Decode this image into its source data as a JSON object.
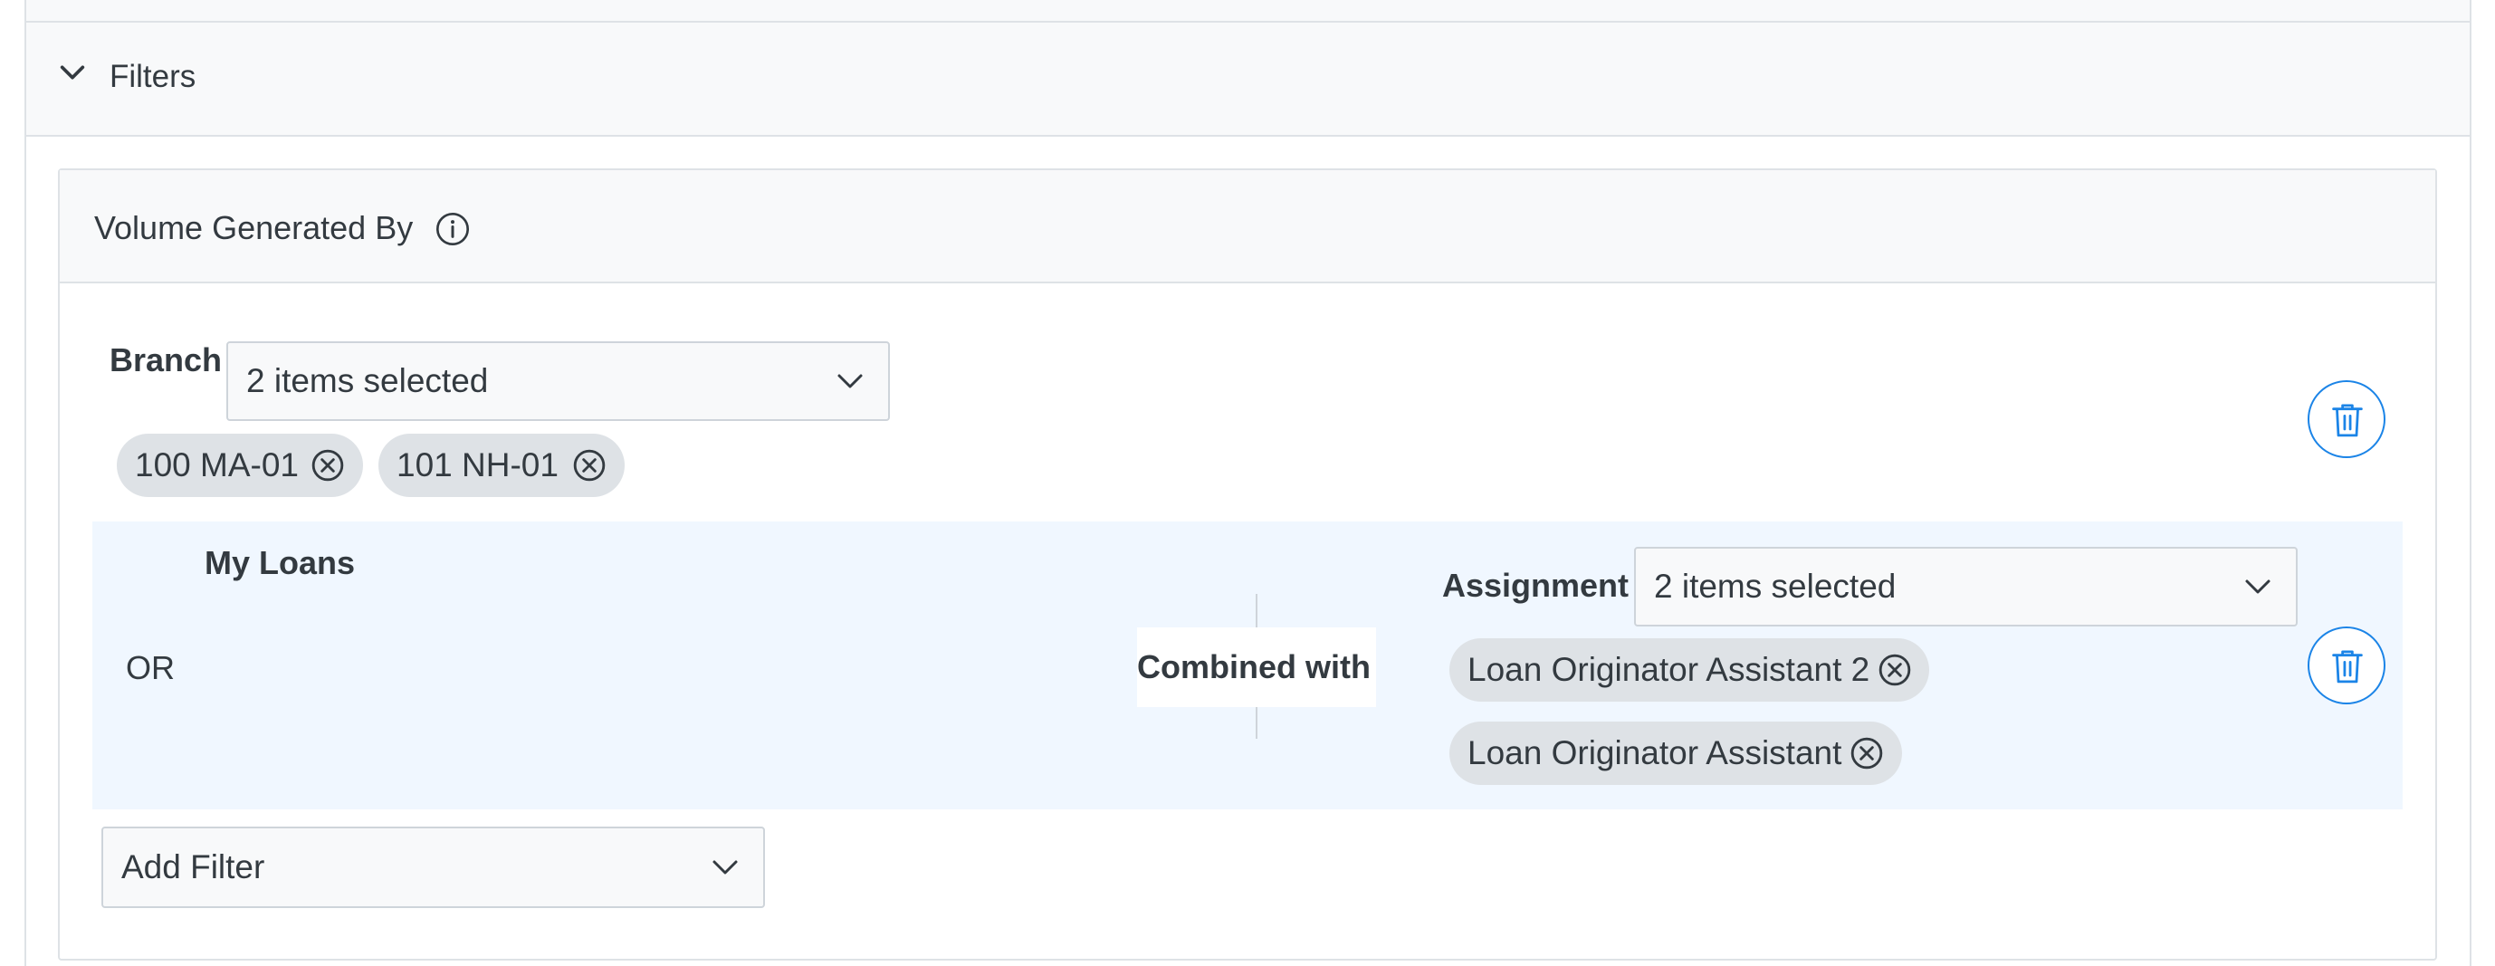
{
  "filters": {
    "title": "Filters",
    "chevron_icon": "chevron-down-icon"
  },
  "card": {
    "title": "Volume Generated By",
    "info_icon": "info-icon"
  },
  "branch": {
    "label": "Branch",
    "select_value": "2 items selected",
    "chips": [
      "100 MA-01",
      "101 NH-01"
    ],
    "remove_icon": "circle-x-icon",
    "delete_icon": "trash-icon"
  },
  "group": {
    "my_loans": "My Loans",
    "or": "OR",
    "combined_with": "Combined with",
    "assignment": {
      "label": "Assignment",
      "select_value": "2 items selected",
      "chips": [
        "Loan Originator Assistant 2",
        "Loan Originator Assistant"
      ]
    },
    "delete_icon": "trash-icon"
  },
  "add_filter": {
    "label": "Add Filter"
  },
  "colors": {
    "accent": "#1b84e7",
    "header_bg": "#f8f9fa",
    "group_bg": "#f0f7ff",
    "chip_bg": "#dee2e6"
  }
}
